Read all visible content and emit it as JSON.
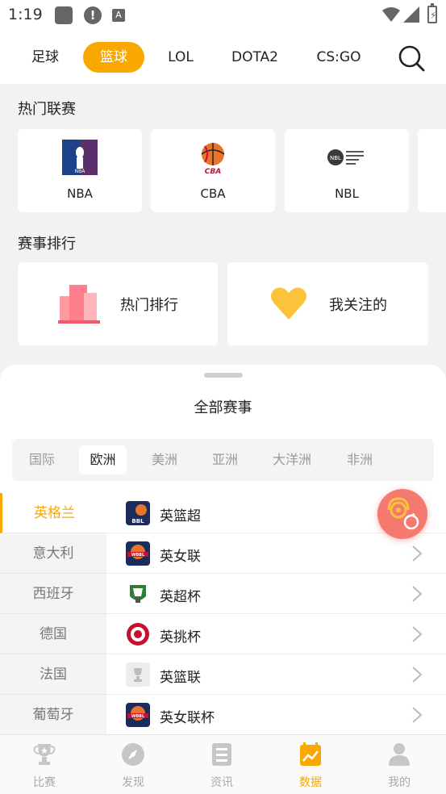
{
  "status_bar": {
    "time": "1:19",
    "alert_glyph": "!",
    "a_glyph": "A"
  },
  "top_tabs": [
    {
      "label": "足球",
      "active": false
    },
    {
      "label": "篮球",
      "active": true
    },
    {
      "label": "LOL",
      "active": false
    },
    {
      "label": "DOTA2",
      "active": false
    },
    {
      "label": "CS:GO",
      "active": false
    }
  ],
  "hot_leagues": {
    "title": "热门联赛",
    "items": [
      {
        "name": "NBA",
        "logo_text": "NBA"
      },
      {
        "name": "CBA",
        "logo_text": "CBA"
      },
      {
        "name": "NBL",
        "logo_text": "NBL"
      }
    ]
  },
  "rankings": {
    "title": "赛事排行",
    "hot_label": "热门排行",
    "follow_label": "我关注的"
  },
  "sheet": {
    "title": "全部赛事",
    "regions": [
      {
        "label": "国际",
        "active": false
      },
      {
        "label": "欧洲",
        "active": true
      },
      {
        "label": "美洲",
        "active": false
      },
      {
        "label": "亚洲",
        "active": false
      },
      {
        "label": "大洋洲",
        "active": false
      },
      {
        "label": "非洲",
        "active": false
      }
    ],
    "countries": [
      {
        "label": "英格兰",
        "active": true
      },
      {
        "label": "意大利",
        "active": false
      },
      {
        "label": "西班牙",
        "active": false
      },
      {
        "label": "德国",
        "active": false
      },
      {
        "label": "法国",
        "active": false
      },
      {
        "label": "葡萄牙",
        "active": false
      }
    ],
    "leagues": [
      {
        "name": "英篮超",
        "logo_text": "BBL"
      },
      {
        "name": "英女联",
        "logo_text": "WBBL"
      },
      {
        "name": "英超杯",
        "logo_text": ""
      },
      {
        "name": "英挑杯",
        "logo_text": ""
      },
      {
        "name": "英篮联",
        "logo_text": ""
      },
      {
        "name": "英女联杯",
        "logo_text": "WBBL"
      }
    ]
  },
  "bottom_nav": [
    {
      "label": "比赛",
      "icon": "trophy-icon",
      "active": false
    },
    {
      "label": "发现",
      "icon": "compass-icon",
      "active": false
    },
    {
      "label": "资讯",
      "icon": "news-icon",
      "active": false
    },
    {
      "label": "数据",
      "icon": "chart-icon",
      "active": true
    },
    {
      "label": "我的",
      "icon": "person-icon",
      "active": false
    }
  ],
  "colors": {
    "accent": "#f9a800",
    "float_button": "#f47a70",
    "background": "#f2f2f2"
  }
}
